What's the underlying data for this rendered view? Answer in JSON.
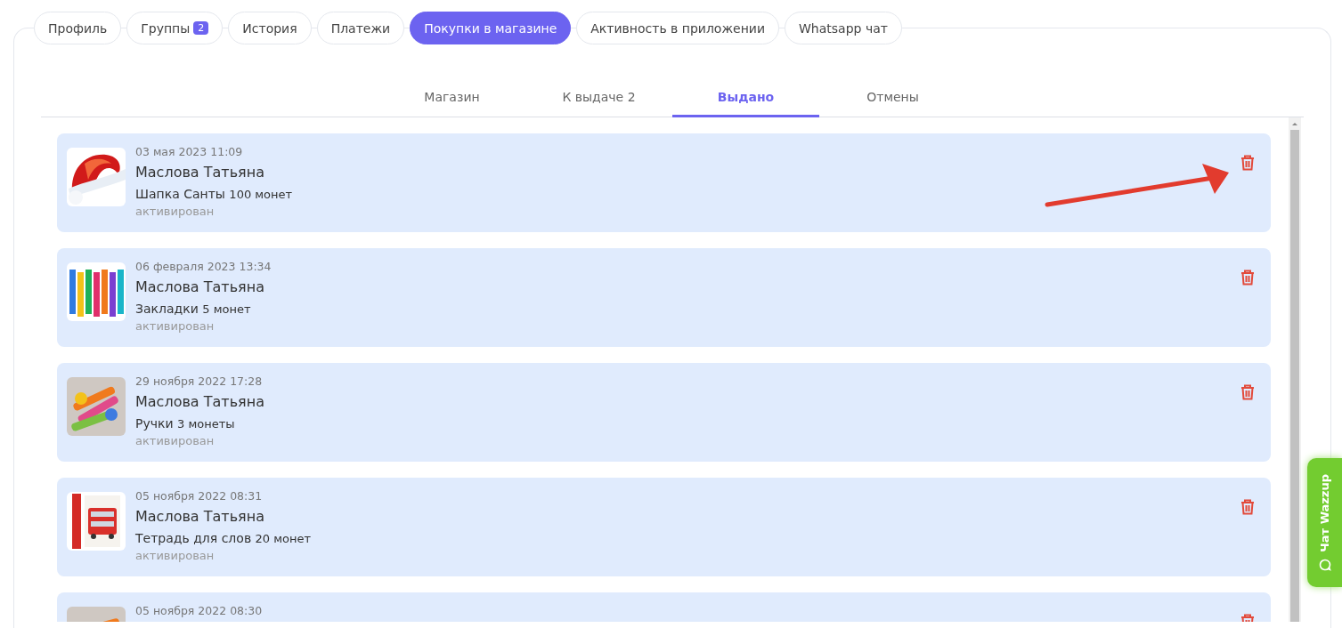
{
  "tabs": [
    {
      "label": "Профиль",
      "selected": false
    },
    {
      "label": "Группы",
      "badge": "2",
      "selected": false
    },
    {
      "label": "История",
      "selected": false
    },
    {
      "label": "Платежи",
      "selected": false
    },
    {
      "label": "Покупки в магазине",
      "selected": true
    },
    {
      "label": "Активность в приложении",
      "selected": false
    },
    {
      "label": "Whatsapp чат",
      "selected": false
    }
  ],
  "subtabs": [
    {
      "label": "Магазин",
      "selected": false
    },
    {
      "label": "К выдаче 2",
      "selected": false
    },
    {
      "label": "Выдано",
      "selected": true
    },
    {
      "label": "Отмены",
      "selected": false
    }
  ],
  "purchases": [
    {
      "date": "03 мая 2023 11:09",
      "customer": "Маслова Татьяна",
      "item": "Шапка Санты",
      "price": "100 монет",
      "status": "активирован"
    },
    {
      "date": "06 февраля 2023 13:34",
      "customer": "Маслова Татьяна",
      "item": "Закладки",
      "price": "5 монет",
      "status": "активирован"
    },
    {
      "date": "29 ноября 2022 17:28",
      "customer": "Маслова Татьяна",
      "item": "Ручки",
      "price": "3 монеты",
      "status": "активирован"
    },
    {
      "date": "05 ноября 2022 08:31",
      "customer": "Маслова Татьяна",
      "item": "Тетрадь для слов",
      "price": "20 монет",
      "status": "активирован"
    },
    {
      "date": "05 ноября 2022 08:30"
    }
  ],
  "chat_button": {
    "label": "Чат Wazzup"
  }
}
